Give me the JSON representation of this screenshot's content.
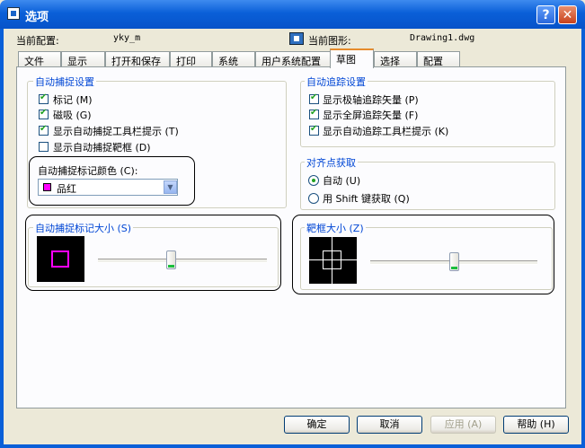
{
  "window": {
    "title": "选项",
    "help_label": "?",
    "close_label": "✕"
  },
  "header": {
    "profile_label": "当前配置:",
    "profile_value": "yky_m",
    "drawing_label": "当前图形:",
    "drawing_value": "Drawing1.dwg"
  },
  "tabs": [
    {
      "label": "文件"
    },
    {
      "label": "显示"
    },
    {
      "label": "打开和保存"
    },
    {
      "label": "打印"
    },
    {
      "label": "系统"
    },
    {
      "label": "用户系统配置"
    },
    {
      "label": "草图",
      "active": true
    },
    {
      "label": "选择"
    },
    {
      "label": "配置"
    }
  ],
  "autosnap": {
    "title": "自动捕捉设置",
    "options": [
      {
        "label": "标记 (M)",
        "checked": true
      },
      {
        "label": "磁吸 (G)",
        "checked": true
      },
      {
        "label": "显示自动捕捉工具栏提示 (T)",
        "checked": true
      },
      {
        "label": "显示自动捕捉靶框 (D)",
        "checked": false
      }
    ],
    "color_label": "自动捕捉标记颜色 (C):",
    "color_value": "品红",
    "color_hex": "#ff00ff"
  },
  "autotrack": {
    "title": "自动追踪设置",
    "options": [
      {
        "label": "显示极轴追踪矢量 (P)",
        "checked": true
      },
      {
        "label": "显示全屏追踪矢量 (F)",
        "checked": true
      },
      {
        "label": "显示自动追踪工具栏提示 (K)",
        "checked": true
      }
    ]
  },
  "alignment": {
    "title": "对齐点获取",
    "options": [
      {
        "label": "自动 (U)",
        "selected": true
      },
      {
        "label": "用 Shift 键获取 (Q)",
        "selected": false
      }
    ]
  },
  "marker_size": {
    "title": "自动捕捉标记大小 (S)",
    "slider_level": 0.43
  },
  "aperture_size": {
    "title": "靶框大小 (Z)",
    "slider_level": 0.5
  },
  "buttons": {
    "ok": "确定",
    "cancel": "取消",
    "apply": "应用 (A)",
    "help": "帮助 (H)"
  },
  "colors": {
    "title_bar": "#0a5fd8",
    "group_title": "#0046d5",
    "check_mark": "#21a121",
    "active_tab_accent": "#e68b2c"
  }
}
